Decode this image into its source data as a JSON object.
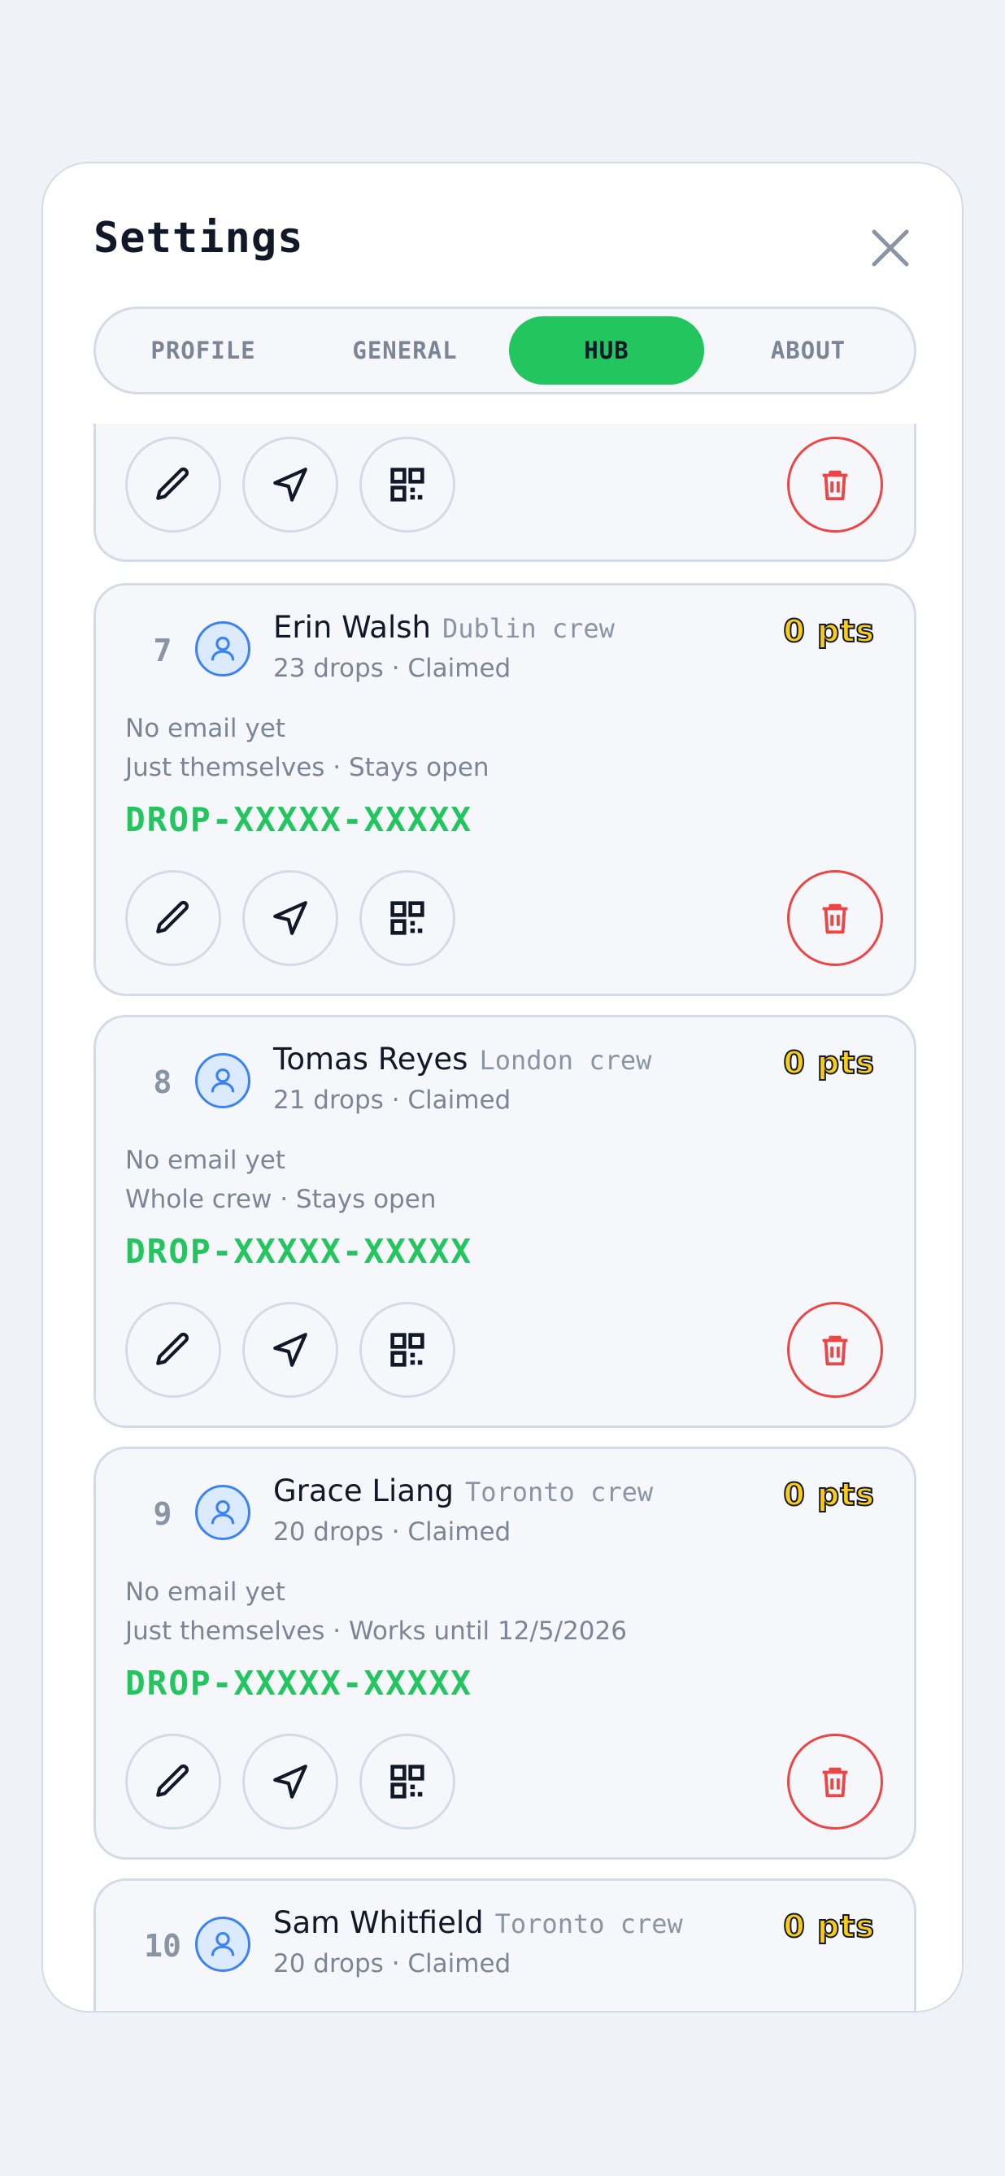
{
  "settings": {
    "title": "Settings",
    "tabs": [
      {
        "label": "PROFILE",
        "active": false
      },
      {
        "label": "GENERAL",
        "active": false
      },
      {
        "label": "HUB",
        "active": true
      },
      {
        "label": "ABOUT",
        "active": false
      }
    ]
  },
  "colors": {
    "accent": "#22c55e",
    "danger": "#ef4444",
    "points": "#facc15",
    "avatar": "#3b82f6"
  },
  "icons": [
    "close-icon",
    "user-icon",
    "pencil-icon",
    "send-icon",
    "qr-code-icon",
    "trash-icon"
  ],
  "members": [
    {
      "rank": "7",
      "name": "Erin Walsh",
      "crew": "Dublin crew",
      "meta": "23 drops · Claimed",
      "points": "0 pts",
      "email": "No email yet",
      "audience": "Just themselves · Stays open",
      "code": "DROP-XXXXX-XXXXX"
    },
    {
      "rank": "8",
      "name": "Tomas Reyes",
      "crew": "London crew",
      "meta": "21 drops · Claimed",
      "points": "0 pts",
      "email": "No email yet",
      "audience": "Whole crew · Stays open",
      "code": "DROP-XXXXX-XXXXX"
    },
    {
      "rank": "9",
      "name": "Grace Liang",
      "crew": "Toronto crew",
      "meta": "20 drops · Claimed",
      "points": "0 pts",
      "email": "No email yet",
      "audience": "Just themselves · Works until 12/5/2026",
      "code": "DROP-XXXXX-XXXXX"
    },
    {
      "rank": "10",
      "name": "Sam Whitfield",
      "crew": "Toronto crew",
      "meta": "20 drops · Claimed",
      "points": "0 pts"
    }
  ]
}
